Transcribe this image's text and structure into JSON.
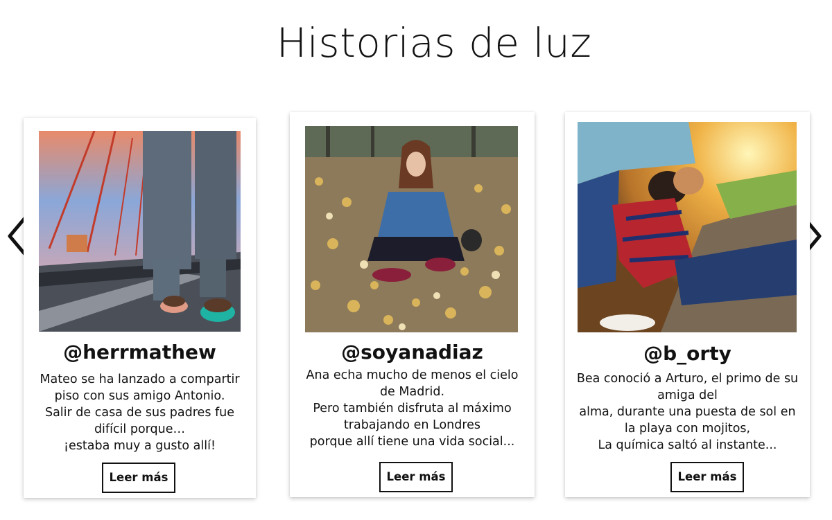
{
  "page": {
    "title": "Historias de luz"
  },
  "carousel": {
    "prev_icon": "chevron-left-icon",
    "next_icon": "chevron-right-icon",
    "cards": [
      {
        "handle": "@herrmathew",
        "photo_subject": "walking-legs-on-bridge-at-sunset",
        "description_lines": [
          "Mateo se ha lanzado a compartir",
          "piso con sus amigo Antonio.",
          "Salir de casa de sus padres fue",
          "difícil porque…",
          "¡estaba muy a gusto allí!"
        ],
        "button_label": "Leer más"
      },
      {
        "handle": "@soyanadiaz",
        "photo_subject": "woman-sitting-on-autumn-leaves",
        "description_lines": [
          "Ana echa mucho de menos el cielo",
          "de Madrid.",
          "Pero también disfruta al máximo",
          "trabajando en Londres",
          "porque allí tiene una vida social..."
        ],
        "button_label": "Leer más"
      },
      {
        "handle": "@b_orty",
        "photo_subject": "couple-kissing-at-sunset",
        "description_lines": [
          "Bea conoció a Arturo, el primo de su",
          "amiga del",
          "alma, durante una puesta de sol en",
          "la playa con mojitos,",
          "La química saltó al instante..."
        ],
        "button_label": "Leer más"
      }
    ]
  },
  "colors": {
    "background": "#ffffff",
    "text": "#111111",
    "button_border": "#111111"
  }
}
